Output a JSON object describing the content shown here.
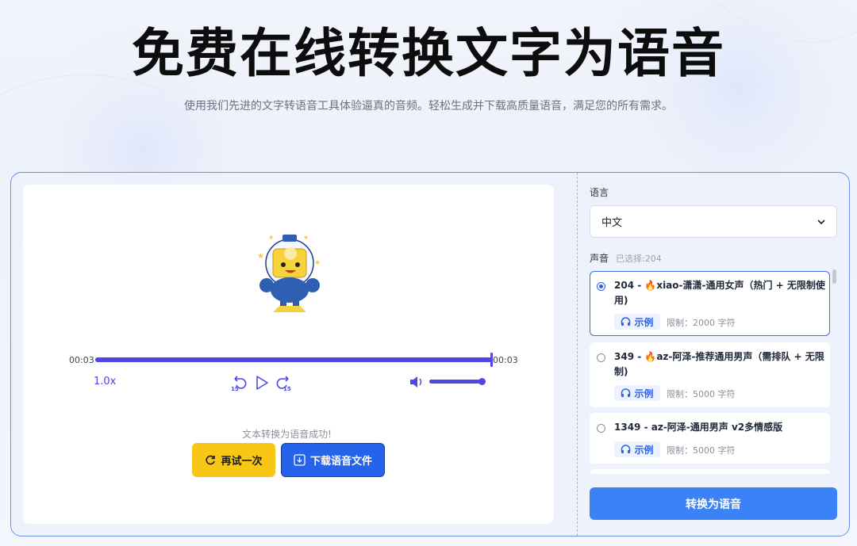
{
  "hero": {
    "title": "免费在线转换文字为语音",
    "subtitle": "使用我们先进的文字转语音工具体验逼真的音频。轻松生成并下载高质量语音，满足您的所有需求。"
  },
  "player": {
    "current_time": "00:03",
    "duration": "00:03",
    "progress_fraction": 1.0,
    "speed": "1.0x",
    "skip_back_seconds": "15",
    "skip_forward_seconds": "15",
    "volume_fraction": 1.0
  },
  "result": {
    "success_message": "文本转换为语音成功!",
    "retry_label": "再试一次",
    "download_label": "下载语音文件"
  },
  "settings": {
    "language_label": "语言",
    "language_value": "中文",
    "voice_label": "声音",
    "voice_selected": "已选择:204",
    "convert_label": "转换为语音"
  },
  "voices": [
    {
      "name": "204 - 🔥xiao-潇潇-通用女声（热门 + 无限制使用)",
      "sample_label": "示例",
      "limit": "限制：2000 字符",
      "selected": true
    },
    {
      "name": "349 - 🔥az-阿泽-推荐通用男声（需排队 + 无限制)",
      "sample_label": "示例",
      "limit": "限制：5000 字符",
      "selected": false
    },
    {
      "name": "1349 - az-阿泽-通用男声 v2多情感版",
      "sample_label": "示例",
      "limit": "限制：5000 字符",
      "selected": false
    }
  ],
  "colors": {
    "accent": "#4f46e5",
    "primary_button": "#3b82f6",
    "download_button": "#2563eb",
    "retry_button": "#f8c614",
    "card_border": "#6b8ff0"
  }
}
